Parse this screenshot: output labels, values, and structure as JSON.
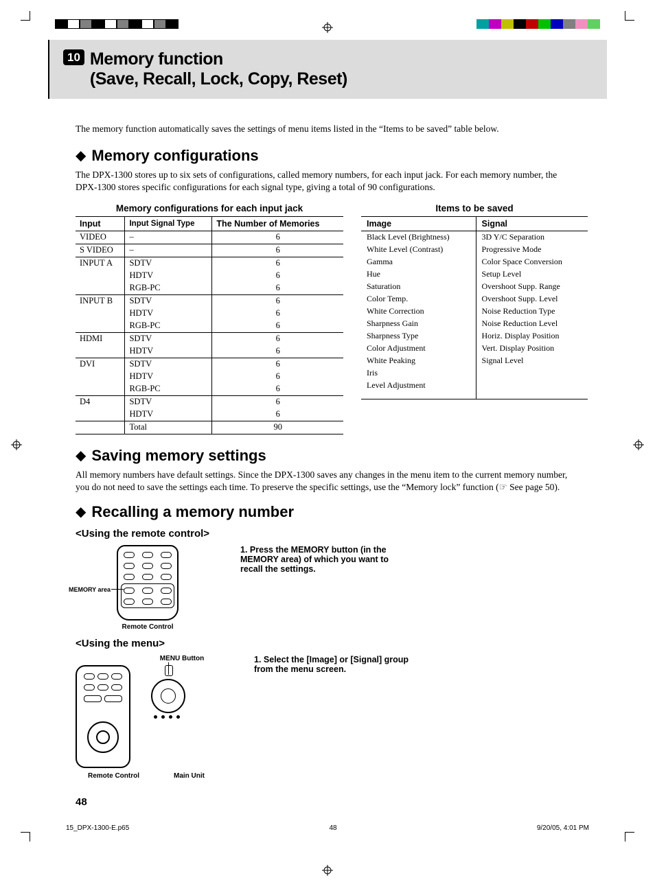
{
  "chapter": {
    "number": "10",
    "title_line1": "Memory function",
    "title_line2": "(Save, Recall, Lock, Copy, Reset)"
  },
  "intro": "The memory function automatically saves the settings of menu items listed in the “Items to be saved” table below.",
  "sec_memcfg": {
    "heading": "Memory configurations",
    "body": "The DPX-1300 stores up to six sets of configurations, called memory numbers, for each input jack.  For each memory number, the DPX-1300 stores specific configurations for each signal type, giving a total of 90 configurations."
  },
  "table1": {
    "caption": "Memory configurations for each input jack",
    "headers": {
      "c1": "Input",
      "c2": "Input Signal Type",
      "c3": "The Number of Memories"
    },
    "groups": [
      {
        "input": "VIDEO",
        "rows": [
          {
            "sig": "–",
            "n": "6"
          }
        ]
      },
      {
        "input": "S VIDEO",
        "rows": [
          {
            "sig": "–",
            "n": "6"
          }
        ]
      },
      {
        "input": "INPUT A",
        "rows": [
          {
            "sig": "SDTV",
            "n": "6"
          },
          {
            "sig": "HDTV",
            "n": "6"
          },
          {
            "sig": "RGB-PC",
            "n": "6"
          }
        ]
      },
      {
        "input": "INPUT B",
        "rows": [
          {
            "sig": "SDTV",
            "n": "6"
          },
          {
            "sig": "HDTV",
            "n": "6"
          },
          {
            "sig": "RGB-PC",
            "n": "6"
          }
        ]
      },
      {
        "input": "HDMI",
        "rows": [
          {
            "sig": "SDTV",
            "n": "6"
          },
          {
            "sig": "HDTV",
            "n": "6"
          }
        ]
      },
      {
        "input": "DVI",
        "rows": [
          {
            "sig": "SDTV",
            "n": "6"
          },
          {
            "sig": "HDTV",
            "n": "6"
          },
          {
            "sig": "RGB-PC",
            "n": "6"
          }
        ]
      },
      {
        "input": "D4",
        "rows": [
          {
            "sig": "SDTV",
            "n": "6"
          },
          {
            "sig": "HDTV",
            "n": "6"
          }
        ]
      }
    ],
    "total": {
      "label": "Total",
      "n": "90"
    }
  },
  "table2": {
    "caption": "Items to be saved",
    "headers": {
      "c1": "Image",
      "c2": "Signal"
    },
    "image_items": [
      "Black Level (Brightness)",
      "White Level (Contrast)",
      "Gamma",
      "Hue",
      "Saturation",
      "Color Temp.",
      "White Correction",
      "Sharpness Gain",
      "Sharpness Type",
      "Color Adjustment",
      "White Peaking",
      "Iris",
      "Level Adjustment"
    ],
    "signal_items": [
      "3D Y/C Separation",
      "Progressive Mode",
      "Color Space Conversion",
      "Setup Level",
      "Overshoot Supp. Range",
      "Overshoot Supp. Level",
      "Noise Reduction Type",
      "Noise Reduction Level",
      "Horiz. Display Position",
      "Vert. Display Position",
      "Signal Level"
    ]
  },
  "sec_save": {
    "heading": "Saving memory settings",
    "body": "All memory numbers have default settings. Since the DPX-1300 saves any changes in the menu item to the current memory number, you do not need to save the settings each time. To preserve the specific settings, use the “Memory lock” function (☞ See page 50)."
  },
  "sec_recall": {
    "heading": "Recalling a memory number",
    "remote": {
      "sub": "<Using the remote control>",
      "mem_label": "MEMORY area",
      "caption": "Remote Control",
      "step": "Press the MEMORY button (in the MEMORY area) of which you want to recall the settings.",
      "step_num": "1."
    },
    "menu": {
      "sub": "<Using the menu>",
      "menu_btn": "MENU Button",
      "cap1": "Remote Control",
      "cap2": "Main Unit",
      "step": "Select the [Image] or [Signal] group from the menu screen.",
      "step_num": "1."
    }
  },
  "pagenum": "48",
  "footer": {
    "file": "15_DPX-1300-E.p65",
    "page": "48",
    "ts": "9/20/05, 4:01 PM"
  },
  "colorbar_left": [
    "#000",
    "#fff",
    "#808080",
    "#000",
    "#fff",
    "#808080",
    "#000",
    "#fff",
    "#808080",
    "#000"
  ],
  "colorbar_right": [
    "#00a0a0",
    "#c000c0",
    "#c0c000",
    "#000",
    "#c00000",
    "#00c000",
    "#0000c0",
    "#808080",
    "#f090c0",
    "#60d060"
  ]
}
